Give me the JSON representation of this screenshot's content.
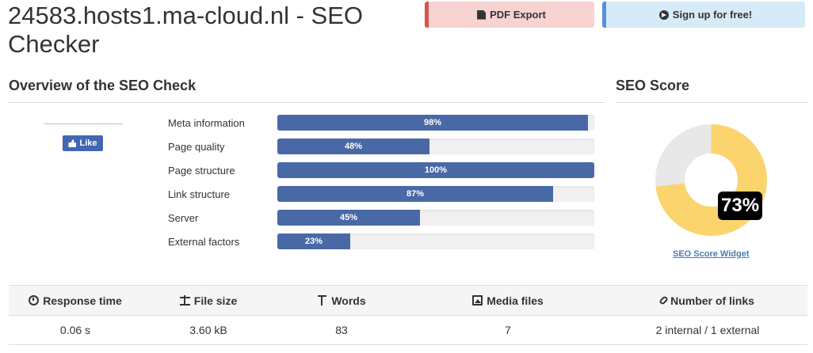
{
  "page": {
    "title": "24583.hosts1.ma-cloud.nl - SEO Checker"
  },
  "actions": {
    "pdf_export_label": "PDF Export",
    "signup_label": "Sign up for free!",
    "pdf_icon": "file-pdf-icon",
    "signup_icon": "arrow-circle-right-icon"
  },
  "overview": {
    "heading": "Overview of the SEO Check",
    "like_label": "Like",
    "metrics": [
      {
        "label": "Meta information",
        "value": 98,
        "value_label": "98%"
      },
      {
        "label": "Page quality",
        "value": 48,
        "value_label": "48%"
      },
      {
        "label": "Page structure",
        "value": 100,
        "value_label": "100%"
      },
      {
        "label": "Link structure",
        "value": 87,
        "value_label": "87%"
      },
      {
        "label": "Server",
        "value": 45,
        "value_label": "45%"
      },
      {
        "label": "External factors",
        "value": 23,
        "value_label": "23%"
      }
    ]
  },
  "score": {
    "heading": "SEO Score",
    "value": 73,
    "value_label": "73%",
    "widget_link": "SEO Score Widget",
    "fill_color": "#fcd46e",
    "track_color": "#e8e8e8"
  },
  "stats": {
    "headers": [
      {
        "label": "Response time",
        "icon": "clock-icon"
      },
      {
        "label": "File size",
        "icon": "scale-icon"
      },
      {
        "label": "Words",
        "icon": "text-icon"
      },
      {
        "label": "Media files",
        "icon": "image-icon"
      },
      {
        "label": "Number of links",
        "icon": "link-icon"
      }
    ],
    "values": [
      "0.06 s",
      "3.60 kB",
      "83",
      "7",
      "2 internal / 1 external"
    ]
  },
  "colors": {
    "bar_fill": "#4869a6",
    "pdf_accent": "#d9534f",
    "signup_accent": "#5a8fd8"
  }
}
